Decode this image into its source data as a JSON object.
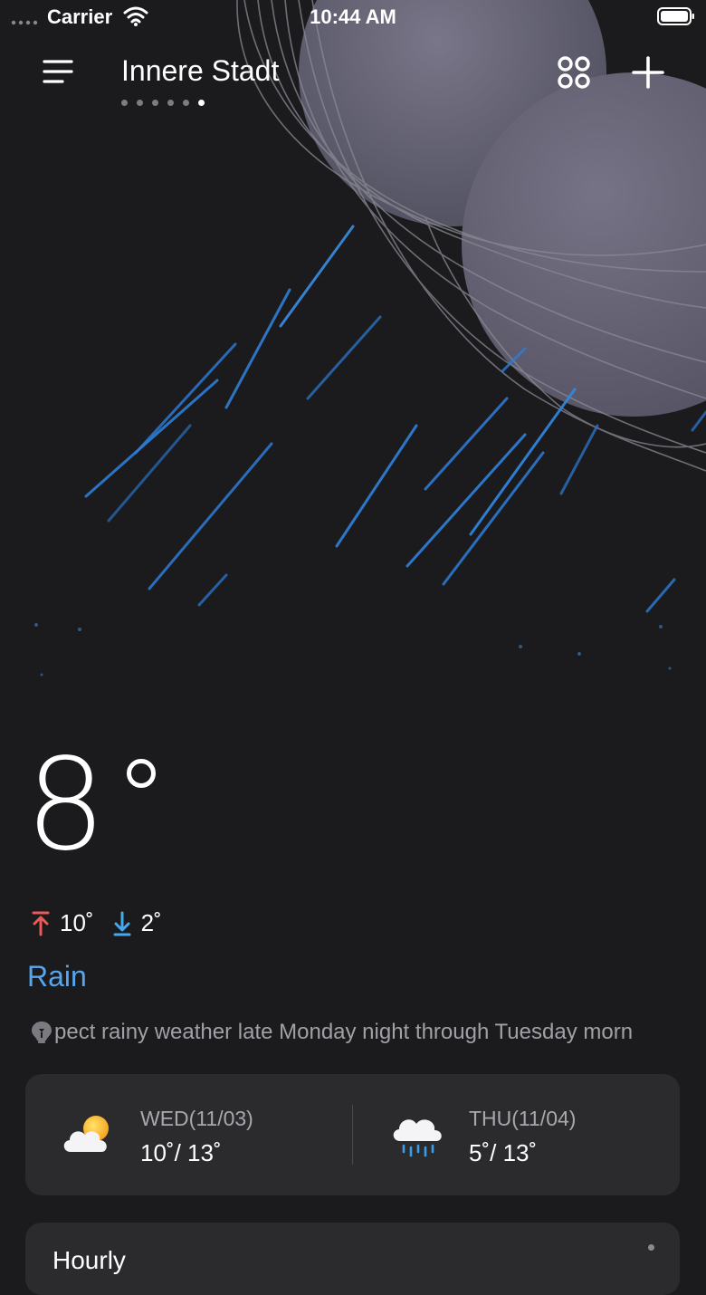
{
  "status_bar": {
    "carrier": "Carrier",
    "time": "10:44 AM"
  },
  "header": {
    "city": "Innere Stadt",
    "page_count": 6,
    "active_page": 5
  },
  "current": {
    "temperature": "8",
    "high": "10˚",
    "low": "2˚",
    "condition": "Rain",
    "tip": "pect rainy weather late Monday night through Tuesday morn"
  },
  "forecast": [
    {
      "date": "WED(11/03)",
      "temps": "10˚/ 13˚",
      "icon": "partly-cloudy-icon"
    },
    {
      "date": "THU(11/04)",
      "temps": "5˚/ 13˚",
      "icon": "rain-cloud-icon"
    }
  ],
  "hourly": {
    "title": "Hourly"
  },
  "colors": {
    "background": "#1b1b1d",
    "card": "#2b2b2e",
    "accent_blue": "#55a6ee",
    "high_arrow": "#e85a5a",
    "low_arrow": "#45a9f0",
    "moon": "#6b6b7a"
  }
}
